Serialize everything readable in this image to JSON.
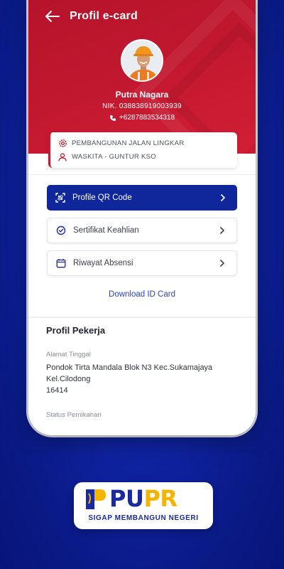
{
  "header": {
    "title": "Profil e-card"
  },
  "profile": {
    "name": "Putra Nagara",
    "nik": "NIK. 038838919003939",
    "phone": "+6287883534318"
  },
  "project": {
    "name": "PEMBANGUNAN JALAN LINGKAR",
    "company": "WASKITA - GUNTUR KSO"
  },
  "menu": {
    "qr_label": "Profile QR Code",
    "certificate_label": "Sertifikat Keahlian",
    "attendance_label": "Riwayat Absensi",
    "download_label": "Download ID Card"
  },
  "worker_profile": {
    "title": "Profil Pekerja",
    "address_label": "Alamat Tinggal",
    "address_line1": "Pondok Tirta Mandala Blok N3 Kec.Sukamajaya",
    "address_line2": "Kel.Cilodong",
    "address_line3": "16414",
    "marital_label": "Status Pernikahan"
  },
  "brand": {
    "logo_pu": "PU",
    "logo_pr": "PR",
    "tagline": "SIGAP MEMBANGUN NEGERI"
  },
  "colors": {
    "header_red": "#c2182f",
    "primary_blue": "#10269b",
    "background_blue": "#1227b0",
    "logo_yellow": "#f4b400"
  },
  "icons": {
    "back": "arrow-left-icon",
    "phone": "phone-icon",
    "project": "gear-icon",
    "company": "person-icon",
    "qr": "qr-scan-icon",
    "certificate": "badge-check-icon",
    "attendance": "calendar-icon",
    "chevron": "chevron-right-icon"
  }
}
